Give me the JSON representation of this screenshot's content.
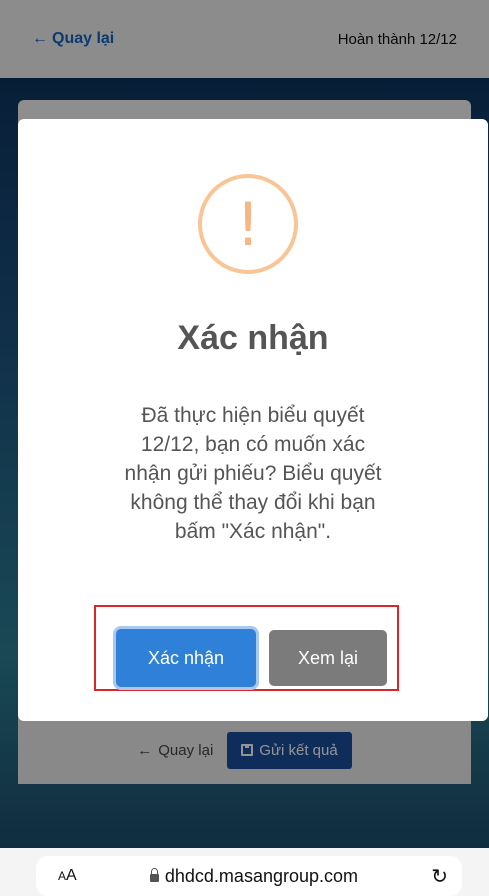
{
  "header": {
    "back_label": "Quay lại",
    "back_arrow": "←",
    "progress_label": "Hoàn thành 12/12"
  },
  "bottom_bar": {
    "back_label": "Quay lại",
    "back_arrow": "←",
    "submit_label": "Gửi kết quả",
    "submit_icon": "save-icon"
  },
  "modal": {
    "icon": "!",
    "title": "Xác nhận",
    "message": "Đã thực hiện biểu quyết 12/12, bạn có muốn xác nhận gửi phiếu? Biểu quyết không thể thay đổi khi bạn bấm \"Xác nhận\".",
    "confirm_label": "Xác nhận",
    "review_label": "Xem lại"
  },
  "browser": {
    "aa_small": "A",
    "aa_large": "A",
    "url": "dhdcd.masangroup.com",
    "reload_icon": "↻"
  },
  "colors": {
    "warning": "#f8c596",
    "primary": "#2e80d8",
    "secondary": "#7b7b7b",
    "highlight_frame": "#d9262c",
    "link": "#1565c0"
  }
}
